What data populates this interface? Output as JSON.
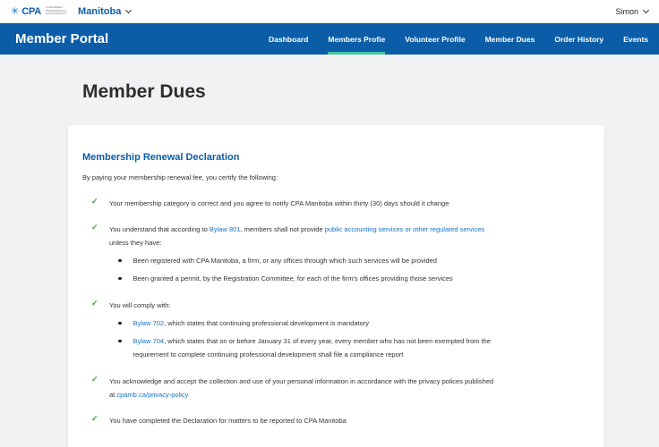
{
  "header": {
    "logo_text": "CPA",
    "logo_sub": [
      "CHARTERED",
      "PROFESSIONAL",
      "ACCOUNTANTS"
    ],
    "province": "Manitoba",
    "user": "Simon"
  },
  "nav": {
    "title": "Member Portal",
    "items": [
      "Dashboard",
      "Members Profie",
      "Volunteer Profile",
      "Member Dues",
      "Order History",
      "Events"
    ],
    "active_index": 1
  },
  "page": {
    "title": "Member Dues"
  },
  "declaration": {
    "title": "Membership Renewal Declaration",
    "intro": "By paying your membership renewal fee, you certify the following:",
    "item1": "Your membership category is correct and you agree to notify CPA Manitoba within thirty (30) days should it change",
    "item2": {
      "pre": "You understand that according to ",
      "link1": "Bylaw 801",
      "mid": ", members shall not provide ",
      "link2": "public accounting services or other regulated services",
      "line2": "unless they have:",
      "sub1": "Been registered with CPA Manitoba, a firm, or any offices through which such services will be provided",
      "sub2": "Been granted a permit, by the Registration Committee, for each of the firm's offices providing those services"
    },
    "item3": {
      "text": "You will comply with:",
      "sub1_link": "Bylaw 702",
      "sub1_text": ", which states that continuing professional development is mandatory",
      "sub2_link": "Bylaw 704",
      "sub2_text": ", which states that on or before January 31 of every year, every member who has not been exempted from the",
      "sub2_line2": "requirement to complete continuing professional development shall file a compliance report"
    },
    "item4": {
      "line1": "You acknowledge and accept the collection and use of your personal information in accordance with the privacy polices published",
      "pre2": "at ",
      "link": "cpamb.ca/privacy-policy"
    },
    "item5": "You have completed the Declaration for matters to be reported to CPA Manitoba"
  },
  "colors": {
    "brand": "#0b5da8",
    "accent": "#45c5a0",
    "check": "#3aa63a",
    "link": "#1671c4"
  },
  "icons": {
    "check": "check-icon",
    "bullet": "bullet-icon",
    "dropdown": "chevron-down-icon",
    "logo": "cpa-maple-leaf-icon"
  }
}
